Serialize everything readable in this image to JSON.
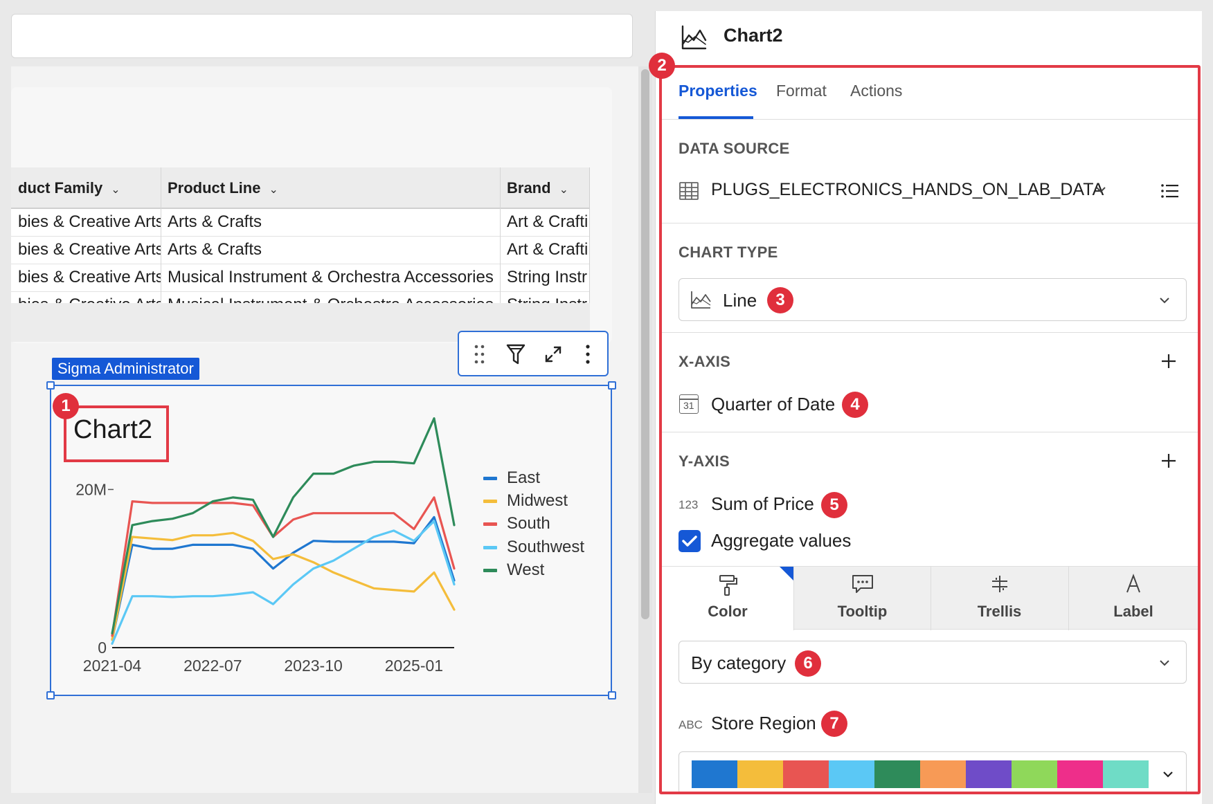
{
  "chart": {
    "title": "Chart2",
    "user_tag": "Sigma Administrator",
    "legend": [
      {
        "name": "East",
        "color": "#1f77d0"
      },
      {
        "name": "Midwest",
        "color": "#f4bd3b"
      },
      {
        "name": "South",
        "color": "#e85552"
      },
      {
        "name": "Southwest",
        "color": "#5bc8f5"
      },
      {
        "name": "West",
        "color": "#2e8b5a"
      }
    ]
  },
  "chart_data": {
    "type": "line",
    "title": "Chart2",
    "x": [
      "2021-04",
      "2021-07",
      "2021-10",
      "2022-01",
      "2022-04",
      "2022-07",
      "2022-10",
      "2023-01",
      "2023-04",
      "2023-07",
      "2023-10",
      "2024-01",
      "2024-04",
      "2024-07",
      "2024-10",
      "2025-01",
      "2025-04",
      "2025-07"
    ],
    "x_tick_labels": [
      "2021-04",
      "2022-07",
      "2023-10",
      "2025-01"
    ],
    "y_tick_labels": [
      "0",
      "20M"
    ],
    "ylim": [
      0,
      28000000
    ],
    "series": [
      {
        "name": "East",
        "color": "#1f77d0",
        "values": [
          1000000,
          13000000,
          12500000,
          12500000,
          13000000,
          13000000,
          13000000,
          12500000,
          10000000,
          12000000,
          13500000,
          13400000,
          13400000,
          13400000,
          13400000,
          13200000,
          16500000,
          8500000
        ]
      },
      {
        "name": "Midwest",
        "color": "#f4bd3b",
        "values": [
          1000000,
          14000000,
          13800000,
          13600000,
          14200000,
          14200000,
          14500000,
          13500000,
          11200000,
          11800000,
          10800000,
          9500000,
          8500000,
          7500000,
          7300000,
          7100000,
          9500000,
          4800000
        ]
      },
      {
        "name": "South",
        "color": "#e85552",
        "values": [
          1500000,
          18500000,
          18300000,
          18300000,
          18300000,
          18300000,
          18300000,
          18000000,
          14000000,
          16200000,
          17000000,
          17000000,
          17000000,
          17000000,
          17000000,
          15000000,
          19000000,
          10000000
        ]
      },
      {
        "name": "Southwest",
        "color": "#5bc8f5",
        "values": [
          500000,
          6500000,
          6500000,
          6400000,
          6500000,
          6500000,
          6700000,
          7000000,
          5500000,
          8000000,
          10000000,
          11000000,
          12500000,
          14000000,
          14800000,
          13500000,
          16000000,
          8000000
        ]
      },
      {
        "name": "West",
        "color": "#2e8b5a",
        "values": [
          1800000,
          15500000,
          16000000,
          16300000,
          17000000,
          18500000,
          19000000,
          18700000,
          14000000,
          19000000,
          22000000,
          22000000,
          23000000,
          23500000,
          23500000,
          23300000,
          29000000,
          15500000
        ]
      }
    ],
    "grid": false,
    "legend_position": "right"
  },
  "table": {
    "columns": [
      "duct Family",
      "Product Line",
      "Brand"
    ],
    "rows": [
      [
        "bies & Creative Arts",
        "Arts & Crafts",
        "Art & Crafti"
      ],
      [
        "bies & Creative Arts",
        "Arts & Crafts",
        "Art & Crafti"
      ],
      [
        "bies & Creative Arts",
        "Musical Instrument & Orchestra Accessories",
        "String Instr"
      ],
      [
        "bies & Creative Arts",
        "Musical Instrument & Orchestra Accessories",
        "String Instr"
      ]
    ]
  },
  "panel": {
    "title": "Chart2",
    "tabs": [
      "Properties",
      "Format",
      "Actions"
    ],
    "active_tab": "Properties",
    "data_source_title": "DATA SOURCE",
    "data_source": "PLUGS_ELECTRONICS_HANDS_ON_LAB_DATA",
    "chart_type_title": "CHART TYPE",
    "chart_type": "Line",
    "x_axis_title": "X-AXIS",
    "x_axis_field": "Quarter of Date",
    "x_axis_icon_text": "31",
    "y_axis_title": "Y-AXIS",
    "y_axis_field": "Sum of Price",
    "y_axis_icon_text": "123",
    "aggregate_label": "Aggregate values",
    "aggregate_checked": true,
    "subtabs": [
      "Color",
      "Tooltip",
      "Trellis",
      "Label"
    ],
    "color_mode": "By category",
    "color_field": "Store Region",
    "color_field_icon_text": "ABC",
    "palette": [
      "#1f77d0",
      "#f4bd3b",
      "#e85552",
      "#5bc8f5",
      "#2e8b5a",
      "#f79a56",
      "#6f4cc8",
      "#8fd85a",
      "#ee2e8a",
      "#6fdcc6"
    ]
  },
  "badges": [
    "1",
    "2",
    "3",
    "4",
    "5",
    "6",
    "7"
  ]
}
